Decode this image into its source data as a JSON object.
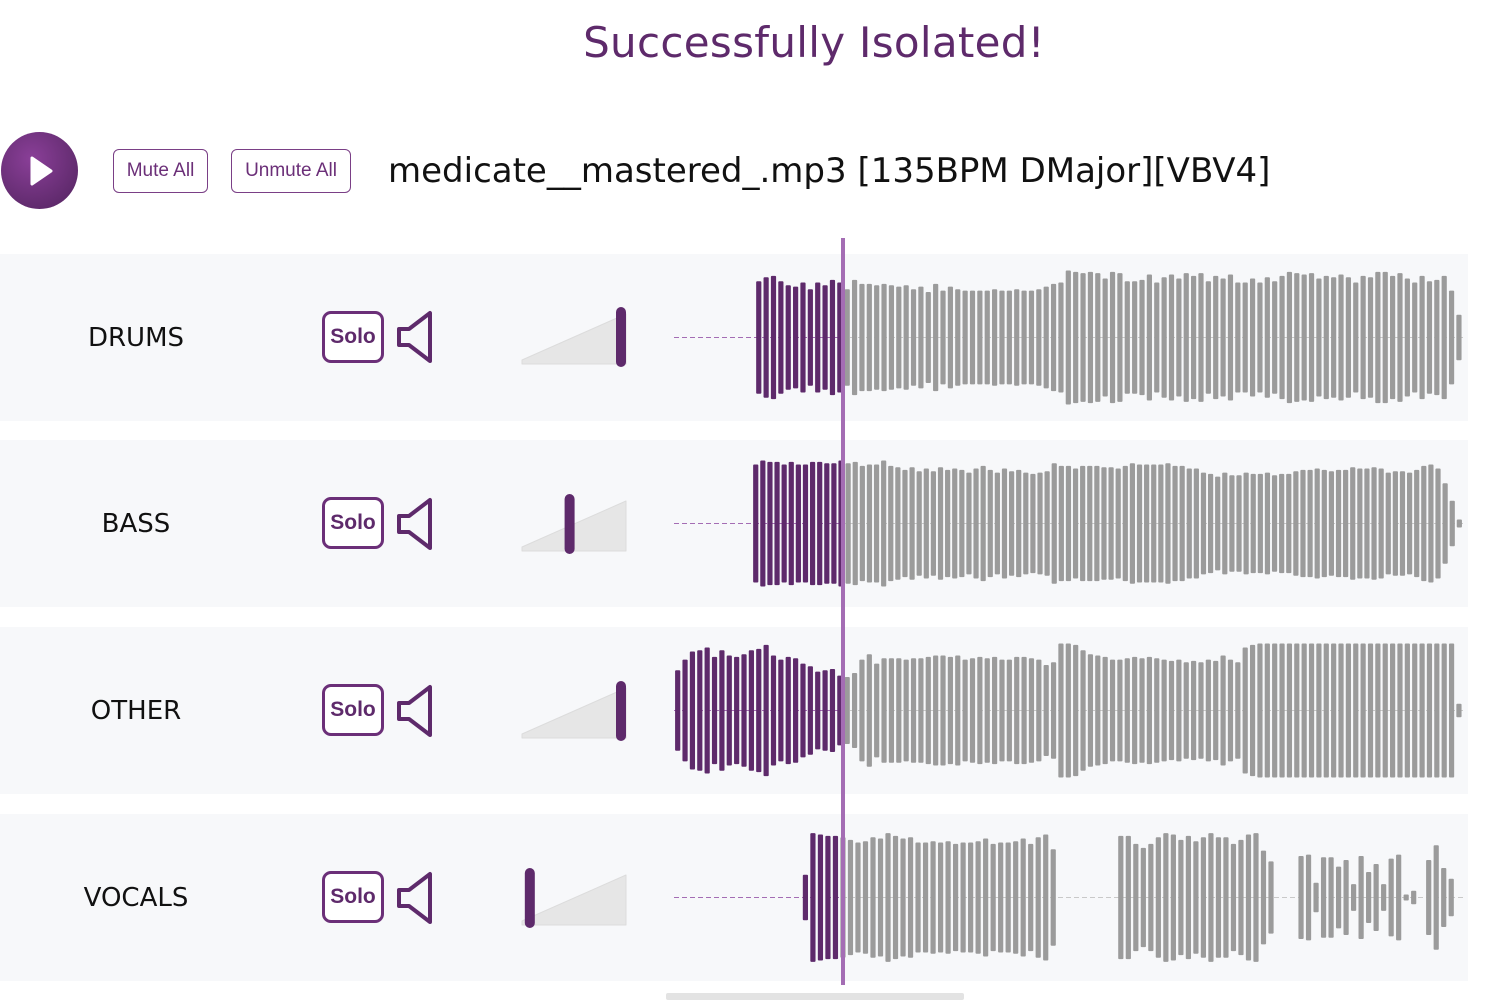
{
  "title": "Successfully Isolated!",
  "controls": {
    "mute_all": "Mute All",
    "unmute_all": "Unmute All",
    "filename": "medicate__mastered_.mp3 [135BPM DMajor][VBV4]"
  },
  "colors": {
    "played": "#5e2a6b",
    "unplayed": "#9b9b9b",
    "playhead": "#a46db4",
    "track_bg": "#f7f8fa"
  },
  "tracks": [
    {
      "name": "DRUMS",
      "solo_label": "Solo",
      "volume": 1.0,
      "waveform": [
        0,
        0,
        0,
        0,
        0,
        0,
        0,
        0,
        0,
        0,
        0,
        0.84,
        0.9,
        0.92,
        0.84,
        0.78,
        0.76,
        0.82,
        0.72,
        0.82,
        0.78,
        0.86,
        0.82,
        0.72,
        0.86,
        0.8,
        0.8,
        0.78,
        0.8,
        0.78,
        0.76,
        0.78,
        0.72,
        0.76,
        0.68,
        0.8,
        0.7,
        0.76,
        0.72,
        0.7,
        0.7,
        0.7,
        0.7,
        0.72,
        0.7,
        0.7,
        0.72,
        0.7,
        0.7,
        0.72,
        0.76,
        0.8,
        0.82,
        1.0,
        0.98,
        0.96,
        0.98,
        0.96,
        0.88,
        0.98,
        0.96,
        0.84,
        0.84,
        0.86,
        0.94,
        0.82,
        0.9,
        0.94,
        0.88,
        0.96,
        0.92,
        0.96,
        0.84,
        0.92,
        0.88,
        0.94,
        0.82,
        0.82,
        0.88,
        0.82,
        0.9,
        0.84,
        0.92,
        0.98,
        0.96,
        0.94,
        0.96,
        0.88,
        0.92,
        0.9,
        0.94,
        0.9,
        0.82,
        0.92,
        0.9,
        0.98,
        0.98,
        0.92,
        0.96,
        0.88,
        0.82,
        0.92,
        0.84,
        0.86,
        0.92,
        0.7,
        0.34
      ]
    },
    {
      "name": "BASS",
      "solo_label": "Solo",
      "volume": 0.47,
      "waveform": [
        0,
        0,
        0,
        0,
        0,
        0,
        0,
        0,
        0,
        0,
        0,
        0.88,
        0.94,
        0.92,
        0.92,
        0.88,
        0.92,
        0.88,
        0.88,
        0.92,
        0.92,
        0.9,
        0.9,
        0.94,
        0.9,
        0.92,
        0.86,
        0.88,
        0.88,
        0.94,
        0.86,
        0.84,
        0.8,
        0.84,
        0.78,
        0.82,
        0.78,
        0.84,
        0.8,
        0.82,
        0.8,
        0.76,
        0.82,
        0.86,
        0.8,
        0.76,
        0.82,
        0.78,
        0.8,
        0.76,
        0.74,
        0.76,
        0.78,
        0.9,
        0.86,
        0.86,
        0.82,
        0.86,
        0.86,
        0.86,
        0.84,
        0.84,
        0.82,
        0.86,
        0.9,
        0.88,
        0.88,
        0.88,
        0.88,
        0.9,
        0.86,
        0.86,
        0.82,
        0.82,
        0.76,
        0.74,
        0.7,
        0.76,
        0.72,
        0.72,
        0.76,
        0.74,
        0.74,
        0.76,
        0.72,
        0.74,
        0.74,
        0.78,
        0.8,
        0.8,
        0.82,
        0.8,
        0.78,
        0.8,
        0.8,
        0.84,
        0.82,
        0.82,
        0.84,
        0.82,
        0.76,
        0.78,
        0.78,
        0.76,
        0.8,
        0.86,
        0.88,
        0.82,
        0.6,
        0.34,
        0.06
      ]
    },
    {
      "name": "OTHER",
      "solo_label": "Solo",
      "volume": 1.0,
      "waveform": [
        0.6,
        0.76,
        0.88,
        0.9,
        0.94,
        0.8,
        0.9,
        0.82,
        0.8,
        0.84,
        0.9,
        0.92,
        0.98,
        0.82,
        0.76,
        0.8,
        0.78,
        0.7,
        0.66,
        0.58,
        0.6,
        0.62,
        0.52,
        0.5,
        0.56,
        0.76,
        0.84,
        0.7,
        0.78,
        0.78,
        0.78,
        0.76,
        0.78,
        0.78,
        0.8,
        0.82,
        0.82,
        0.8,
        0.82,
        0.76,
        0.78,
        0.8,
        0.78,
        0.8,
        0.76,
        0.76,
        0.8,
        0.8,
        0.78,
        0.76,
        0.68,
        0.72,
        1.0,
        1.0,
        0.98,
        0.9,
        0.84,
        0.82,
        0.8,
        0.76,
        0.76,
        0.78,
        0.8,
        0.78,
        0.8,
        0.78,
        0.76,
        0.74,
        0.76,
        0.72,
        0.74,
        0.72,
        0.76,
        0.74,
        0.82,
        0.76,
        0.72,
        0.94,
        0.98,
        1.0,
        1.0,
        1.0,
        1.0,
        1.0,
        1.0,
        1.0,
        1.0,
        1.0,
        1.0,
        1.0,
        1.0,
        1.0,
        1.0,
        1.0,
        1.0,
        1.0,
        1.0,
        1.0,
        1.0,
        1.0,
        1.0,
        1.0,
        1.0,
        1.0,
        1.0,
        1.0,
        0.1
      ]
    },
    {
      "name": "VOCALS",
      "solo_label": "Solo",
      "volume": 0.06,
      "waveform": [
        0,
        0,
        0,
        0,
        0,
        0,
        0,
        0,
        0,
        0,
        0,
        0,
        0,
        0,
        0,
        0,
        0,
        0.34,
        0.96,
        0.94,
        0.92,
        0.92,
        0.9,
        0.86,
        0.82,
        0.84,
        0.9,
        0.88,
        0.96,
        0.92,
        0.88,
        0.9,
        0.82,
        0.82,
        0.84,
        0.82,
        0.84,
        0.8,
        0.82,
        0.82,
        0.84,
        0.88,
        0.8,
        0.82,
        0.82,
        0.84,
        0.88,
        0.8,
        0.9,
        0.94,
        0.72,
        0,
        0,
        0,
        0,
        0,
        0,
        0,
        0,
        0.92,
        0.92,
        0.8,
        0.74,
        0.8,
        0.9,
        0.96,
        0.94,
        0.86,
        0.92,
        0.84,
        0.9,
        0.96,
        0.9,
        0.9,
        0.8,
        0.86,
        0.94,
        0.96,
        0.7,
        0.54,
        0,
        0,
        0,
        0.62,
        0.64,
        0.22,
        0.6,
        0.6,
        0.46,
        0.56,
        0.2,
        0.62,
        0.38,
        0.5,
        0.2,
        0.58,
        0.64,
        0.04,
        0.1,
        0,
        0.56,
        0.78,
        0.44,
        0.28,
        0
      ]
    }
  ]
}
